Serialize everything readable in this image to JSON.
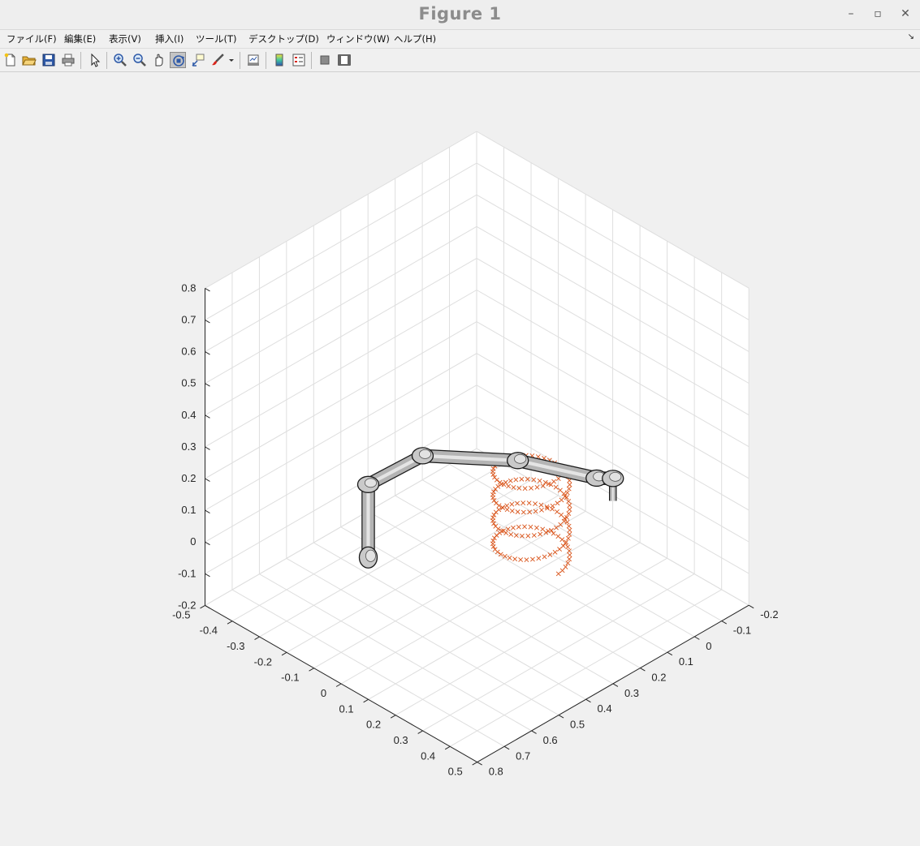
{
  "window": {
    "title": "Figure 1",
    "controls": {
      "minimize": "–",
      "maximize": "▫",
      "close": "✕"
    }
  },
  "menubar": {
    "items": [
      {
        "label": "ファイル(F)"
      },
      {
        "label": "編集(E)"
      },
      {
        "label": "表示(V)"
      },
      {
        "label": "挿入(I)"
      },
      {
        "label": "ツール(T)"
      },
      {
        "label": "デスクトップ(D)"
      },
      {
        "label": "ウィンドウ(W)"
      },
      {
        "label": "ヘルプ(H)"
      }
    ],
    "dock_icon": "undock-arrow-icon"
  },
  "toolbar": {
    "buttons": [
      {
        "icon": "new-figure-icon"
      },
      {
        "icon": "open-folder-icon"
      },
      {
        "icon": "save-icon"
      },
      {
        "icon": "print-icon"
      },
      {
        "icon": "edit-plot-arrow-icon"
      },
      {
        "icon": "zoom-in-icon"
      },
      {
        "icon": "zoom-out-icon"
      },
      {
        "icon": "pan-hand-icon"
      },
      {
        "icon": "rotate-3d-icon",
        "active": true
      },
      {
        "icon": "data-cursor-icon"
      },
      {
        "icon": "brush-icon"
      },
      {
        "icon": "brush-dropdown-icon"
      },
      {
        "icon": "link-plot-icon"
      },
      {
        "icon": "insert-colorbar-icon"
      },
      {
        "icon": "insert-legend-icon"
      },
      {
        "icon": "hide-plot-tools-icon"
      },
      {
        "icon": "show-plot-tools-icon"
      }
    ]
  },
  "chart_data": {
    "type": "scatter",
    "title": "",
    "xlabel": "",
    "ylabel": "",
    "zlabel": "",
    "xlim": [
      -0.5,
      0.5
    ],
    "ylim": [
      -0.2,
      0.8
    ],
    "zlim": [
      -0.2,
      0.8
    ],
    "x_ticks": [
      "-0.5",
      "-0.4",
      "-0.3",
      "-0.2",
      "-0.1",
      "0",
      "0.1",
      "0.2",
      "0.3",
      "0.4",
      "0.5"
    ],
    "y_ticks": [
      "-0.2",
      "-0.1",
      "0",
      "0.1",
      "0.2",
      "0.3",
      "0.4",
      "0.5",
      "0.6",
      "0.7",
      "0.8"
    ],
    "z_ticks": [
      "-0.2",
      "-0.1",
      "0",
      "0.1",
      "0.2",
      "0.3",
      "0.4",
      "0.5",
      "0.6",
      "0.7",
      "0.8"
    ],
    "grid": true,
    "view": "3d",
    "trajectory": {
      "marker": "x",
      "color": "#d95319",
      "shape": "helix",
      "center": [
        0.0,
        0.1
      ],
      "radius": 0.1,
      "z_range": [
        -0.15,
        0.15
      ],
      "turns": 4
    },
    "robot_arm": {
      "color": "#b4b4b4",
      "edge_color": "#1a1a1a",
      "joints": [
        [
          -0.1,
          0.6,
          0.05
        ],
        [
          -0.1,
          0.6,
          0.28
        ],
        [
          0.05,
          0.55,
          0.42
        ],
        [
          0.2,
          0.35,
          0.38
        ],
        [
          0.32,
          0.18,
          0.3
        ],
        [
          0.25,
          0.05,
          0.2
        ],
        [
          0.2,
          0.0,
          0.08
        ]
      ]
    }
  }
}
